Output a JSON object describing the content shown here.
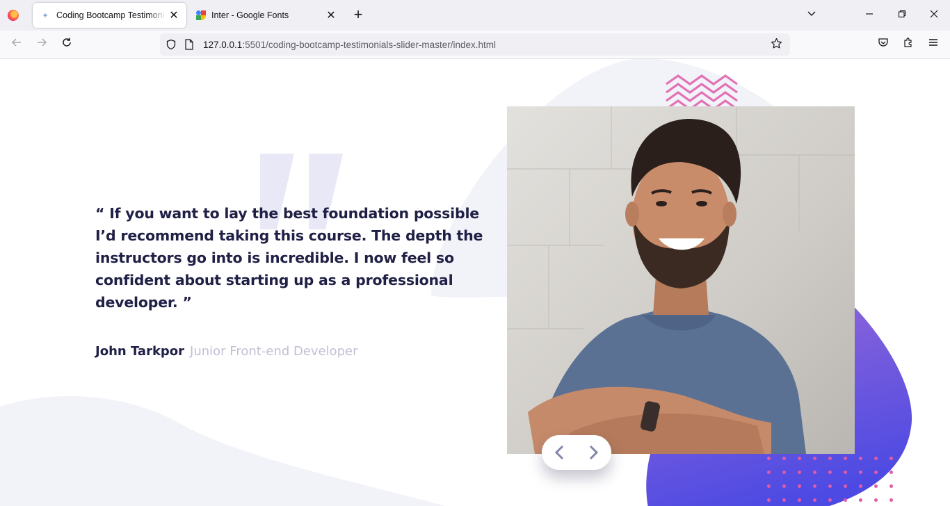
{
  "browser": {
    "tabs": [
      {
        "title": "Coding Bootcamp Testimonials Slider",
        "active": true,
        "close": "✕"
      },
      {
        "title": "Inter - Google Fonts",
        "active": false,
        "close": "✕"
      }
    ],
    "new_tab": "+",
    "url_host": "127.0.0.1",
    "url_rest": ":5501/coding-bootcamp-testimonials-slider-master/index.html",
    "icons": [
      "firefox-icon",
      "back-icon",
      "forward-icon",
      "reload-icon",
      "shield-icon",
      "page-icon",
      "star-icon",
      "pocket-icon",
      "extensions-icon",
      "menu-icon",
      "tab-list-icon",
      "minimize-icon",
      "restore-icon",
      "close-icon"
    ]
  },
  "testimonial": {
    "quote": "“ If you want to lay the best foundation possible I’d recommend taking this course. The depth the instructors go into is incredible. I now feel so confident about starting up as a professional developer. ”",
    "name": "John Tarkpor",
    "role": "Junior Front-end Developer"
  },
  "colors": {
    "dark_blue": "#202046",
    "grayish_blue": "#c0c0d6",
    "light_grayish_blue": "#f2f2f9",
    "gradient_start": "#4d4ae3",
    "gradient_end": "#9c6bd6",
    "accent_pink": "#e05ba8",
    "nav_arrow": "#8585ac"
  }
}
